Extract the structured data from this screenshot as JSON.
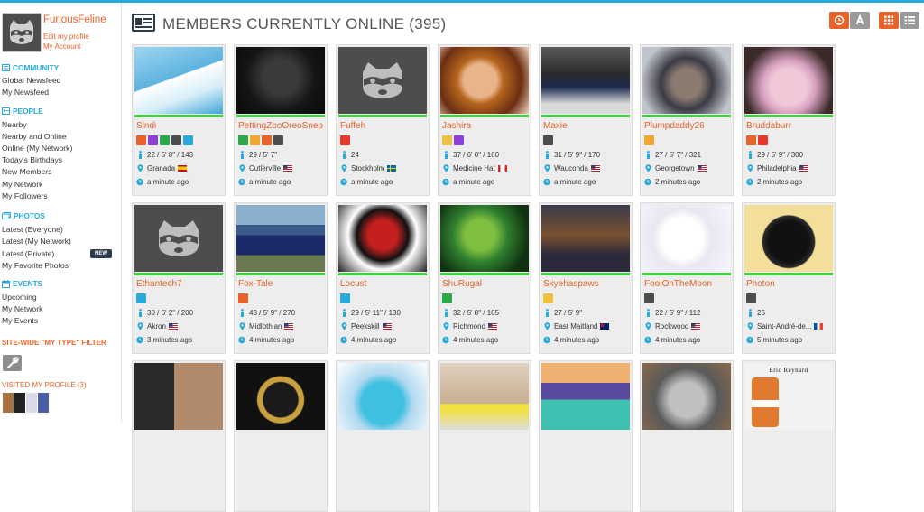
{
  "profile": {
    "name": "FuriousFeline",
    "edit_link": "Edit my profile",
    "account_link": "My Account"
  },
  "sidebar": {
    "community": {
      "title": "COMMUNITY",
      "items": [
        "Global Newsfeed",
        "My Newsfeed"
      ]
    },
    "people": {
      "title": "PEOPLE",
      "items": [
        "Nearby",
        "Nearby and Online",
        "Online (My Network)",
        "Today's Birthdays",
        "New Members",
        "My Network",
        "My Followers"
      ]
    },
    "photos": {
      "title": "PHOTOS",
      "items": [
        "Latest (Everyone)",
        "Latest (My Network)",
        "Latest (Private)",
        "My Favorite Photos"
      ],
      "new_badge": "NEW"
    },
    "events": {
      "title": "EVENTS",
      "items": [
        "Upcoming",
        "My Network",
        "My Events"
      ]
    },
    "filter_title": "SITE-WIDE \"MY TYPE\" FILTER",
    "visited_title": "VISITED MY PROFILE (3)"
  },
  "header": {
    "title": "MEMBERS CURRENTLY ONLINE (395)"
  },
  "colors": {
    "accent": "#29a9d9",
    "brand_orange": "#e8632a",
    "online_green": "#3fd13f"
  },
  "members": [
    {
      "name": "Sindi",
      "badges": [
        "#e8632a",
        "#8e3fd8",
        "#2aa84a",
        "#4d4d4d",
        "#29a9d9"
      ],
      "age": "22 / 5' 8\" / 143",
      "location": "Granada",
      "flag": "es",
      "seen": "a minute ago"
    },
    {
      "name": "PettingZooOreoSnep",
      "badges": [
        "#2aa84a",
        "#f0a830",
        "#e8632a",
        "#4d4d4d"
      ],
      "age": "29 / 5' 7\"",
      "location": "Cutlerville",
      "flag": "us",
      "seen": "a minute ago"
    },
    {
      "name": "Fuffeh",
      "badges": [
        "#e8382a"
      ],
      "age": "24",
      "location": "Stockholm",
      "flag": "se",
      "seen": "a minute ago"
    },
    {
      "name": "Jashira",
      "badges": [
        "#f0c040",
        "#8e3fd8"
      ],
      "age": "37 / 6' 0\" / 160",
      "location": "Medicine Hat",
      "flag": "ca",
      "seen": "a minute ago"
    },
    {
      "name": "Maxie",
      "badges": [
        "#4d4d4d"
      ],
      "age": "31 / 5' 9\" / 170",
      "location": "Wauconda",
      "flag": "us",
      "seen": "a minute ago"
    },
    {
      "name": "Plumpdaddy26",
      "badges": [
        "#f0a830"
      ],
      "age": "27 / 5' 7\" / 321",
      "location": "Georgetown",
      "flag": "us",
      "seen": "2 minutes ago"
    },
    {
      "name": "Bruddaburr",
      "badges": [
        "#e8632a",
        "#e8382a"
      ],
      "age": "29 / 5' 9\" / 300",
      "location": "Philadelphia",
      "flag": "us",
      "seen": "2 minutes ago"
    },
    {
      "name": "Ethantech7",
      "badges": [
        "#29a9d9"
      ],
      "age": "30 / 6' 2\" / 200",
      "location": "Akron",
      "flag": "us",
      "seen": "3 minutes ago"
    },
    {
      "name": "Fox-Tale",
      "badges": [
        "#e8632a"
      ],
      "age": "43 / 5' 9\" / 270",
      "location": "Midlothian",
      "flag": "us",
      "seen": "4 minutes ago"
    },
    {
      "name": "Locust",
      "badges": [
        "#29a9d9"
      ],
      "age": "29 / 5' 11\" / 130",
      "location": "Peekskill",
      "flag": "us",
      "seen": "4 minutes ago"
    },
    {
      "name": "ShuRugal",
      "badges": [
        "#2aa84a"
      ],
      "age": "32 / 5' 8\" / 165",
      "location": "Richmond",
      "flag": "us",
      "seen": "4 minutes ago"
    },
    {
      "name": "Skyehaspaws",
      "badges": [
        "#f0c040"
      ],
      "age": "27 / 5' 9\"",
      "location": "East Maitland",
      "flag": "au",
      "seen": "4 minutes ago"
    },
    {
      "name": "FoolOnTheMoon",
      "badges": [
        "#4d4d4d"
      ],
      "age": "22 / 5' 9\" / 112",
      "location": "Rockwood",
      "flag": "us",
      "seen": "4 minutes ago"
    },
    {
      "name": "Photon",
      "badges": [
        "#4d4d4d"
      ],
      "age": "26",
      "location": "Saint-André-de...",
      "flag": "fr",
      "seen": "5 minutes ago"
    }
  ],
  "row3_caption": "Eric Reynard"
}
